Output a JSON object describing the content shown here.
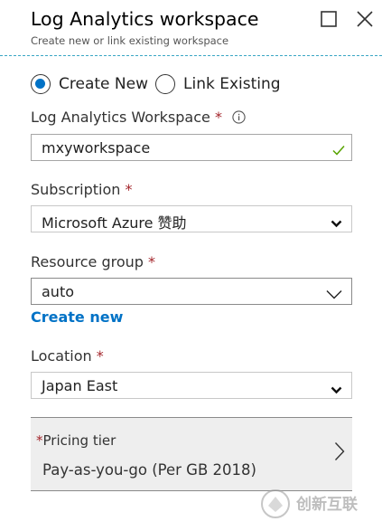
{
  "blade": {
    "title": "Log Analytics workspace",
    "subtitle": "Create new or link existing workspace",
    "controls": {
      "maximize_icon": "maximize-icon",
      "close_icon": "close-icon"
    }
  },
  "mode": {
    "options": [
      {
        "label": "Create New",
        "selected": true
      },
      {
        "label": "Link Existing",
        "selected": false
      }
    ]
  },
  "workspace": {
    "label": "Log Analytics Workspace",
    "required_mark": "*",
    "value": "mxyworkspace",
    "valid_icon": "check-icon",
    "info_icon": "info-icon"
  },
  "subscription": {
    "label": "Subscription",
    "required_mark": "*",
    "value": "Microsoft Azure 赞助"
  },
  "resource_group": {
    "label": "Resource group",
    "required_mark": "*",
    "value": "auto",
    "create_new_link": "Create new"
  },
  "location": {
    "label": "Location",
    "required_mark": "*",
    "value": "Japan East"
  },
  "pricing": {
    "required_mark": "*",
    "label": "Pricing tier",
    "value": "Pay-as-you-go (Per GB 2018)"
  },
  "watermark": {
    "text": "创新互联"
  },
  "colors": {
    "accent": "#0072c6",
    "required": "#a4262c",
    "valid": "#57a300",
    "separator": "#3aa6c4"
  }
}
